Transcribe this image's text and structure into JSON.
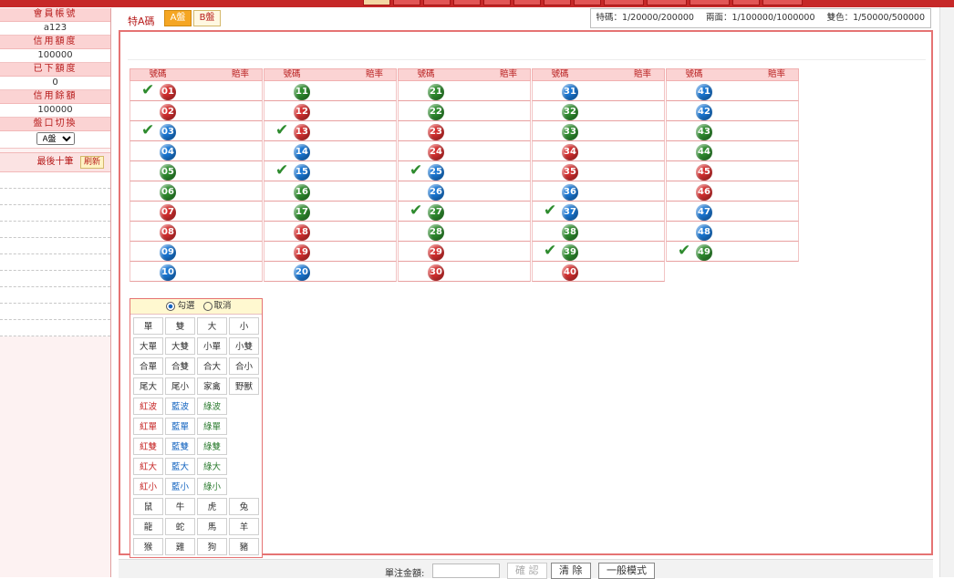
{
  "sidebar": {
    "items": [
      {
        "label": "會員帳號",
        "value": "a123"
      },
      {
        "label": "信用額度",
        "value": "100000"
      },
      {
        "label": "已下額度",
        "value": "0"
      },
      {
        "label": "信用餘額",
        "value": "100000"
      }
    ],
    "switch_label": "盤口切換",
    "switch_value": "A盤",
    "recent_label": "最後十筆",
    "refresh_label": "刷新"
  },
  "header": {
    "title": "特A碼",
    "tab_a": "A盤",
    "tab_b": "B盤",
    "odds": [
      "特碼：1/20000/200000",
      "兩面：1/100000/1000000",
      "雙色：1/50000/500000"
    ]
  },
  "columns": {
    "number_header": "號碼",
    "odds_header": "賠率"
  },
  "balls": [
    {
      "n": "01",
      "c": "red",
      "check": true
    },
    {
      "n": "02",
      "c": "red"
    },
    {
      "n": "03",
      "c": "blue",
      "check": true
    },
    {
      "n": "04",
      "c": "blue"
    },
    {
      "n": "05",
      "c": "green"
    },
    {
      "n": "06",
      "c": "green"
    },
    {
      "n": "07",
      "c": "red"
    },
    {
      "n": "08",
      "c": "red"
    },
    {
      "n": "09",
      "c": "blue"
    },
    {
      "n": "10",
      "c": "blue"
    },
    {
      "n": "11",
      "c": "green"
    },
    {
      "n": "12",
      "c": "red"
    },
    {
      "n": "13",
      "c": "red",
      "check": true
    },
    {
      "n": "14",
      "c": "blue"
    },
    {
      "n": "15",
      "c": "blue",
      "check": true
    },
    {
      "n": "16",
      "c": "green"
    },
    {
      "n": "17",
      "c": "green"
    },
    {
      "n": "18",
      "c": "red"
    },
    {
      "n": "19",
      "c": "red"
    },
    {
      "n": "20",
      "c": "blue"
    },
    {
      "n": "21",
      "c": "green"
    },
    {
      "n": "22",
      "c": "green"
    },
    {
      "n": "23",
      "c": "red"
    },
    {
      "n": "24",
      "c": "red"
    },
    {
      "n": "25",
      "c": "blue",
      "check": true
    },
    {
      "n": "26",
      "c": "blue"
    },
    {
      "n": "27",
      "c": "green",
      "check": true
    },
    {
      "n": "28",
      "c": "green"
    },
    {
      "n": "29",
      "c": "red"
    },
    {
      "n": "30",
      "c": "red"
    },
    {
      "n": "31",
      "c": "blue"
    },
    {
      "n": "32",
      "c": "green"
    },
    {
      "n": "33",
      "c": "green"
    },
    {
      "n": "34",
      "c": "red"
    },
    {
      "n": "35",
      "c": "red"
    },
    {
      "n": "36",
      "c": "blue"
    },
    {
      "n": "37",
      "c": "blue",
      "check": true
    },
    {
      "n": "38",
      "c": "green"
    },
    {
      "n": "39",
      "c": "green",
      "check": true
    },
    {
      "n": "40",
      "c": "red"
    },
    {
      "n": "41",
      "c": "blue"
    },
    {
      "n": "42",
      "c": "blue"
    },
    {
      "n": "43",
      "c": "green"
    },
    {
      "n": "44",
      "c": "green"
    },
    {
      "n": "45",
      "c": "red"
    },
    {
      "n": "46",
      "c": "red"
    },
    {
      "n": "47",
      "c": "blue"
    },
    {
      "n": "48",
      "c": "blue"
    },
    {
      "n": "49",
      "c": "green",
      "check": true
    }
  ],
  "quick_select": {
    "select_label": "勾選",
    "cancel_label": "取消",
    "buttons": [
      {
        "t": "單",
        "c": ""
      },
      {
        "t": "雙",
        "c": ""
      },
      {
        "t": "大",
        "c": ""
      },
      {
        "t": "小",
        "c": ""
      },
      {
        "t": "大單",
        "c": ""
      },
      {
        "t": "大雙",
        "c": ""
      },
      {
        "t": "小單",
        "c": ""
      },
      {
        "t": "小雙",
        "c": ""
      },
      {
        "t": "合單",
        "c": ""
      },
      {
        "t": "合雙",
        "c": ""
      },
      {
        "t": "合大",
        "c": ""
      },
      {
        "t": "合小",
        "c": ""
      },
      {
        "t": "尾大",
        "c": ""
      },
      {
        "t": "尾小",
        "c": ""
      },
      {
        "t": "家禽",
        "c": ""
      },
      {
        "t": "野獸",
        "c": ""
      },
      {
        "t": "紅波",
        "c": "red"
      },
      {
        "t": "藍波",
        "c": "blue"
      },
      {
        "t": "綠波",
        "c": "green"
      },
      {
        "t": "",
        "c": "empty"
      },
      {
        "t": "紅單",
        "c": "red"
      },
      {
        "t": "藍單",
        "c": "blue"
      },
      {
        "t": "綠單",
        "c": "green"
      },
      {
        "t": "",
        "c": "empty"
      },
      {
        "t": "紅雙",
        "c": "red"
      },
      {
        "t": "藍雙",
        "c": "blue"
      },
      {
        "t": "綠雙",
        "c": "green"
      },
      {
        "t": "",
        "c": "empty"
      },
      {
        "t": "紅大",
        "c": "red"
      },
      {
        "t": "藍大",
        "c": "blue"
      },
      {
        "t": "綠大",
        "c": "green"
      },
      {
        "t": "",
        "c": "empty"
      },
      {
        "t": "紅小",
        "c": "red"
      },
      {
        "t": "藍小",
        "c": "blue"
      },
      {
        "t": "綠小",
        "c": "green"
      },
      {
        "t": "",
        "c": "empty"
      },
      {
        "t": "鼠",
        "c": ""
      },
      {
        "t": "牛",
        "c": ""
      },
      {
        "t": "虎",
        "c": ""
      },
      {
        "t": "兔",
        "c": ""
      },
      {
        "t": "龍",
        "c": ""
      },
      {
        "t": "蛇",
        "c": ""
      },
      {
        "t": "馬",
        "c": ""
      },
      {
        "t": "羊",
        "c": ""
      },
      {
        "t": "猴",
        "c": ""
      },
      {
        "t": "雞",
        "c": ""
      },
      {
        "t": "狗",
        "c": ""
      },
      {
        "t": "豬",
        "c": ""
      }
    ]
  },
  "bottom": {
    "amount_label": "單注金額:",
    "confirm": "確 認",
    "clear": "清 除",
    "general_mode": "一般模式"
  },
  "colors": {
    "red": "#d32f2f",
    "blue": "#1976d2",
    "green": "#2e8b2e",
    "accent": "#c62828"
  }
}
